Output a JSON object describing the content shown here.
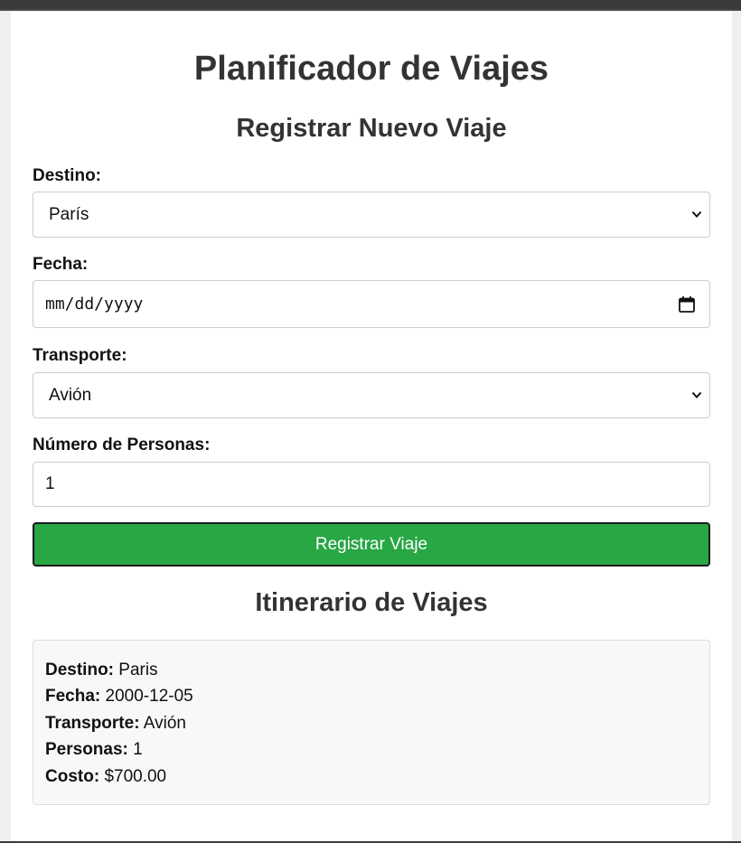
{
  "app": {
    "title": "Planificador de Viajes"
  },
  "form": {
    "heading": "Registrar Nuevo Viaje",
    "destination": {
      "label": "Destino:",
      "selected": "París"
    },
    "date": {
      "label": "Fecha:",
      "placeholder": "mm/dd/yyyy"
    },
    "transport": {
      "label": "Transporte:",
      "selected": "Avión"
    },
    "people": {
      "label": "Número de Personas:",
      "value": "1"
    },
    "submit_label": "Registrar Viaje"
  },
  "itinerary": {
    "heading": "Itinerario de Viajes",
    "trips": [
      {
        "destination_label": "Destino:",
        "destination": "Paris",
        "date_label": "Fecha:",
        "date": "2000-12-05",
        "transport_label": "Transporte:",
        "transport": "Avión",
        "people_label": "Personas:",
        "people": "1",
        "cost_label": "Costo:",
        "cost": "$700.00"
      }
    ]
  },
  "colors": {
    "accent": "#28a745",
    "text": "#333333",
    "card_bg": "#f8f8f8"
  },
  "icons": {
    "select_arrow": "chevron-down-icon",
    "date_picker": "calendar-icon"
  }
}
